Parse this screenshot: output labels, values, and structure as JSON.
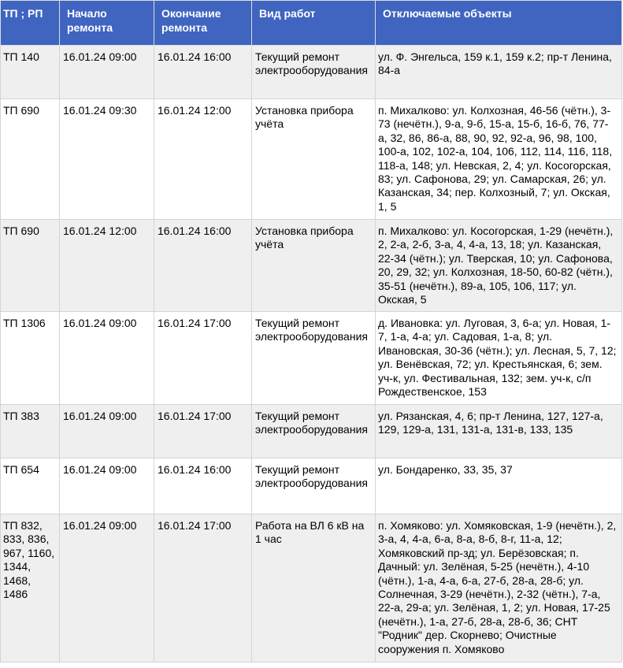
{
  "table": {
    "headers": [
      "ТП ; РП",
      "Начало ремонта",
      "Окончание ремонта",
      "Вид работ",
      "Отключаемые объекты"
    ],
    "rows": [
      {
        "tp": "ТП 140",
        "start": "16.01.24 09:00",
        "end": "16.01.24 16:00",
        "work": "Текущий ремонт электрооборудования",
        "objects": "ул. Ф. Энгельса, 159 к.1, 159 к.2; пр-т Ленина, 84-а"
      },
      {
        "tp": "ТП 690",
        "start": "16.01.24 09:30",
        "end": "16.01.24 12:00",
        "work": "Установка прибора учёта",
        "objects": "п. Михалково: ул. Колхозная, 46-56 (чётн.), 3-73 (нечётн.), 9-а, 9-б, 15-а, 15-б, 16-б, 76, 77-а, 32, 86, 86-а, 88, 90, 92, 92-а, 96, 98, 100, 100-а, 102, 102-а, 104, 106, 112, 114, 116, 118, 118-а, 148; ул. Невская, 2, 4; ул. Косогорская, 83; ул. Сафонова, 29; ул. Самарская, 26; ул. Казанская, 34; пер. Колхозный, 7; ул. Окская, 1, 5"
      },
      {
        "tp": "ТП 690",
        "start": "16.01.24 12:00",
        "end": "16.01.24 16:00",
        "work": "Установка прибора учёта",
        "objects": "п. Михалково: ул. Косогорская, 1-29 (нечётн.), 2, 2-а, 2-б, 3-а, 4, 4-а, 13, 18; ул. Казанская, 22-34 (чётн.); ул. Тверская, 10; ул. Сафонова, 20, 29, 32; ул. Колхозная, 18-50, 60-82 (чётн.), 35-51 (нечётн.), 89-а, 105, 106, 117; ул. Окская, 5"
      },
      {
        "tp": "ТП 1306",
        "start": "16.01.24 09:00",
        "end": "16.01.24 17:00",
        "work": "Текущий ремонт электрооборудования",
        "objects": "д. Ивановка: ул. Луговая, 3, 6-а; ул. Новая, 1-7, 1-а, 4-а; ул. Садовая, 1-а, 8; ул. Ивановская, 30-36 (чётн.); ул. Лесная, 5, 7, 12; ул. Венёвская, 72; ул. Крестьянская, 6; зем. уч-к, ул. Фестивальная, 132; зем. уч-к, с/п Рождественское, 153"
      },
      {
        "tp": "ТП 383",
        "start": "16.01.24 09:00",
        "end": "16.01.24 17:00",
        "work": "Текущий ремонт электрооборудования",
        "objects": "ул. Рязанская, 4, 6; пр-т Ленина, 127, 127-а, 129, 129-а, 131, 131-а, 131-в, 133, 135"
      },
      {
        "tp": "ТП 654",
        "start": "16.01.24 09:00",
        "end": "16.01.24 16:00",
        "work": "Текущий ремонт электрооборудования",
        "objects": "ул. Бондаренко, 33, 35, 37"
      },
      {
        "tp": "ТП 832, 833, 836, 967, 1160, 1344, 1468, 1486",
        "start": "16.01.24 09:00",
        "end": "16.01.24 17:00",
        "work": "Работа на ВЛ 6 кВ на 1 час",
        "objects": "п. Хомяково: ул. Хомяковская, 1-9 (нечётн.), 2, 3-а, 4, 4-а, 6-а, 8-а, 8-б, 8-г, 11-а, 12; Хомяковский пр-зд; ул. Берёзовская; п. Дачный: ул. Зелёная, 5-25 (нечётн.), 4-10 (чётн.), 1-а, 4-а, 6-а, 27-б, 28-а, 28-б; ул. Солнечная, 3-29 (нечётн.), 2-32 (чётн.), 7-а, 22-а, 29-а; ул. Зелёная, 1, 2; ул. Новая, 17-25 (нечётн.), 1-а, 27-б, 28-а, 28-б, 36; СНТ \"Родник\" дер. Скорнево; Очистные сооружения п. Хомяково"
      }
    ]
  }
}
